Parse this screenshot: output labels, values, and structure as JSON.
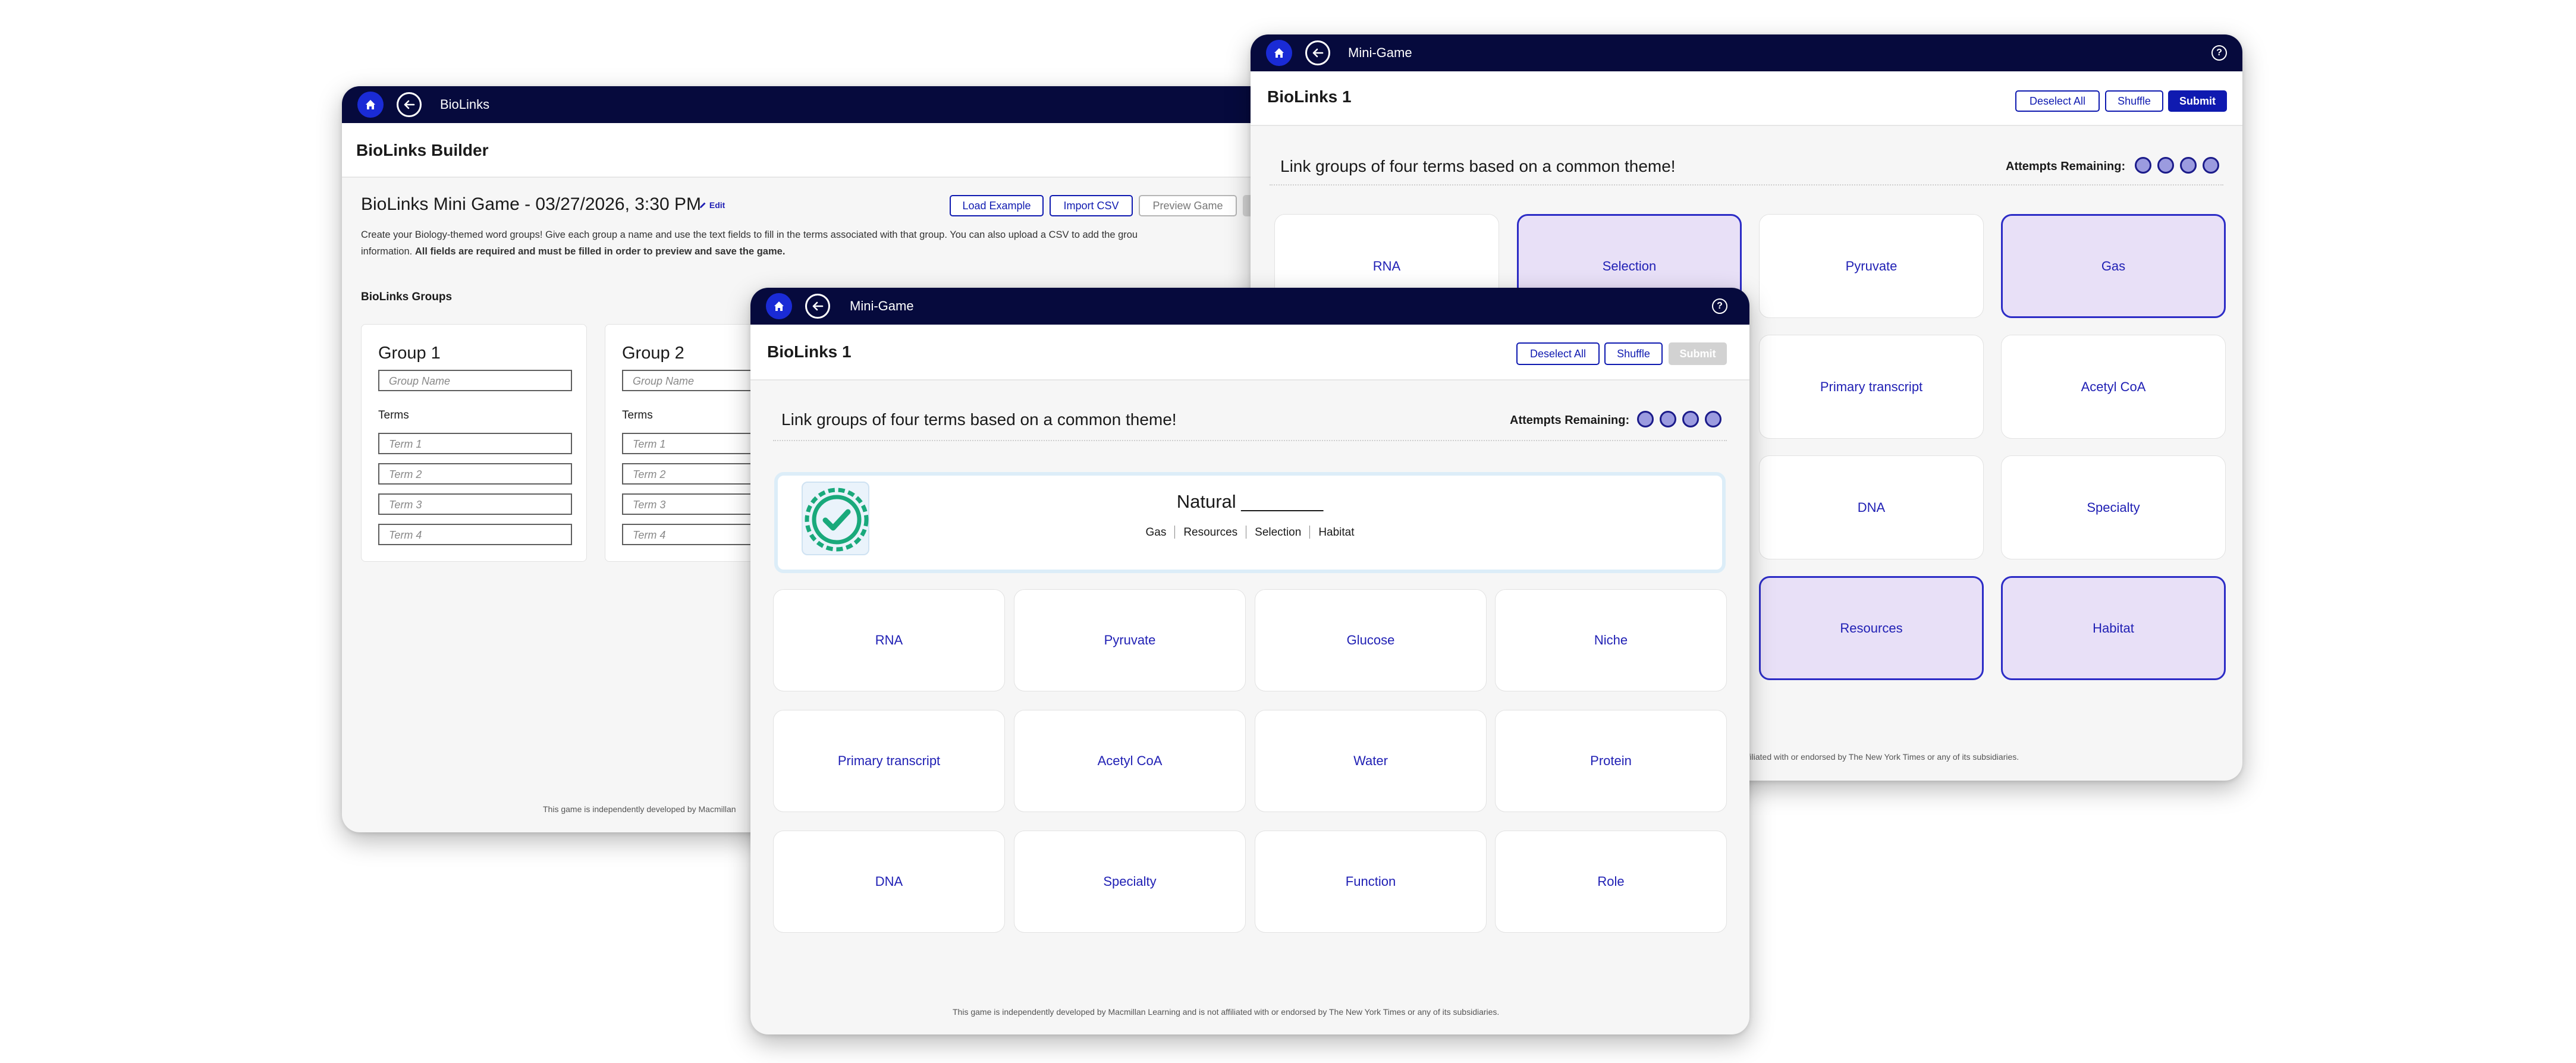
{
  "builder": {
    "app_title": "BioLinks",
    "header_title": "BioLinks Builder",
    "game_title": "BioLinks Mini Game - 03/27/2026, 3:30 PM",
    "edit_label": "Edit",
    "buttons": {
      "load_example": "Load Example",
      "import_csv": "Import CSV",
      "preview_game": "Preview Game"
    },
    "description": "Create your Biology-themed word groups! Give each group a name and use the text fields to fill in the terms associated with that group. You can also upload a CSV to add the grou",
    "description_line2": "information.",
    "description_bold": "All fields are required and must be filled in order to preview and save the game.",
    "groups_heading": "BioLinks Groups",
    "groups": [
      {
        "title": "Group 1",
        "name_placeholder": "Group Name",
        "terms_label": "Terms",
        "terms": [
          "Term 1",
          "Term 2",
          "Term 3",
          "Term 4"
        ]
      },
      {
        "title": "Group 2",
        "name_placeholder": "Group Name",
        "terms_label": "Terms",
        "terms": [
          "Term 1",
          "Term 2",
          "Term 3",
          "Term 4"
        ]
      }
    ],
    "footnote": "This game is independently developed by Macmillan"
  },
  "game_back": {
    "app_title": "Mini-Game",
    "header_title": "BioLinks 1",
    "buttons": {
      "deselect_all": "Deselect All",
      "shuffle": "Shuffle",
      "submit": "Submit"
    },
    "prompt": "Link groups of four terms based on a common theme!",
    "attempts_label": "Attempts Remaining:",
    "attempts_remaining": 4,
    "tiles": [
      {
        "label": "RNA",
        "selected": false
      },
      {
        "label": "Selection",
        "selected": true
      },
      {
        "label": "Pyruvate",
        "selected": false
      },
      {
        "label": "Gas",
        "selected": true
      },
      {
        "label": "Primary transcript",
        "selected": false
      },
      {
        "label": "Acetyl CoA",
        "selected": false
      },
      {
        "label": "DNA",
        "selected": false
      },
      {
        "label": "Specialty",
        "selected": false
      },
      {
        "label": "Resources",
        "selected": true
      },
      {
        "label": "Habitat",
        "selected": true
      }
    ],
    "footnote": "ffiliated with or endorsed by The New York Times or any of its subsidiaries."
  },
  "game_front": {
    "app_title": "Mini-Game",
    "header_title": "BioLinks 1",
    "buttons": {
      "deselect_all": "Deselect All",
      "shuffle": "Shuffle",
      "submit": "Submit"
    },
    "prompt": "Link groups of four terms based on a common theme!",
    "attempts_label": "Attempts Remaining:",
    "attempts_remaining": 4,
    "solved": {
      "title": "Natural ________",
      "terms": [
        "Gas",
        "Resources",
        "Selection",
        "Habitat"
      ]
    },
    "tiles": [
      "RNA",
      "Pyruvate",
      "Glucose",
      "Niche",
      "Primary transcript",
      "Acetyl CoA",
      "Water",
      "Protein",
      "DNA",
      "Specialty",
      "Function",
      "Role"
    ],
    "footnote": "This game is independently developed by Macmillan Learning and is not affiliated with or endorsed by The New York Times or any of its subsidiaries."
  },
  "colors": {
    "nav_bar": "#060a3d",
    "accent": "#0f1ab0",
    "selected_tile": "#e8e0f7",
    "solved_green": "#19a97b"
  }
}
